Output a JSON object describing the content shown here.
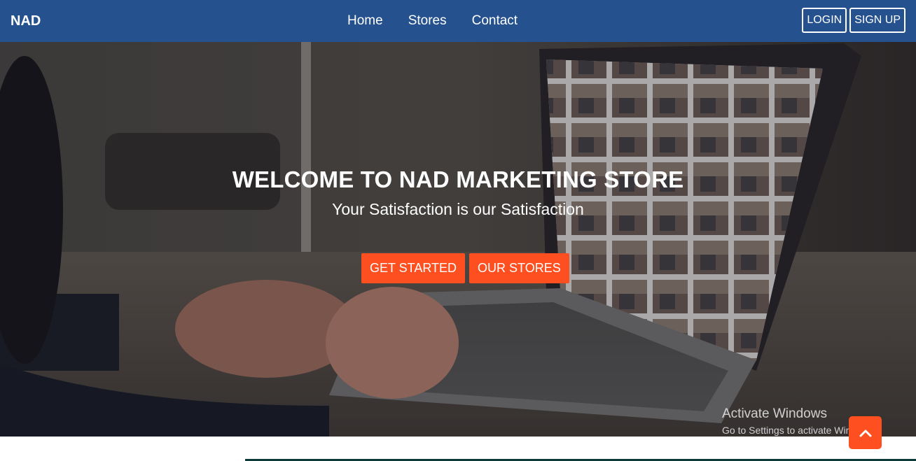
{
  "brand": {
    "name": "NAD"
  },
  "nav": {
    "links": [
      {
        "label": "Home"
      },
      {
        "label": "Stores"
      },
      {
        "label": "Contact"
      }
    ],
    "login_label": "LOGIN",
    "signup_label": "SIGN UP"
  },
  "hero": {
    "title": "WELCOME TO NAD MARKETING STORE",
    "subtitle": "Your Satisfaction is our Satisfaction",
    "primary_cta": "GET STARTED",
    "secondary_cta": "OUR STORES"
  },
  "watermark": {
    "title": "Activate Windows",
    "subtitle": "Go to Settings to activate Windows."
  },
  "colors": {
    "navbar": "#25518f",
    "accent": "#fd4f1f",
    "text": "#ffffff"
  },
  "icons": {
    "back_to_top": "chevron-up-icon"
  }
}
